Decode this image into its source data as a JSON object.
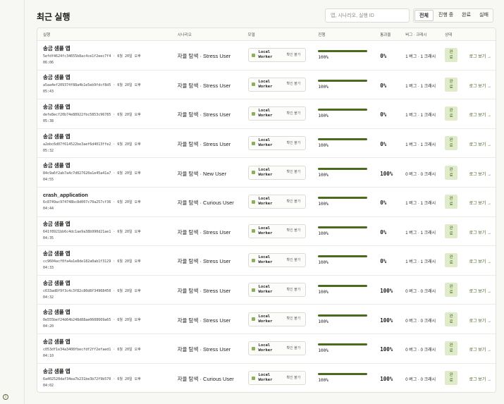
{
  "header": {
    "title": "최근 실행",
    "search_placeholder": "앱, 시나리오, 실행 ID",
    "tabs": [
      "전체",
      "진행 중",
      "완료",
      "실패"
    ],
    "active_tab": "전체"
  },
  "table": {
    "columns": [
      "실행",
      "시나리오",
      "모델",
      "진행",
      "통과율",
      "버그 · 크래시",
      "상태"
    ],
    "rows": [
      {
        "name": "송금 샘플 앱",
        "id": "5efdf4624fc34655b8ac4ce1f2eec7f4",
        "date": "6월 20일 오후",
        "time": "06:06",
        "scenario": "자율 탐색 · Stress User",
        "model": "Local Worker",
        "model_state": "확인 불가",
        "progress": 1.0,
        "progress_label": "100%",
        "pass_rate": "0%",
        "bugs": "1 버그 · 1 크래시",
        "status": "완료",
        "action": "로그 보기 →"
      },
      {
        "name": "송금 샘플 앱",
        "id": "a5aa4ef209374f88a4b1e5eb9fdcf8d5",
        "date": "6월 20일 오후",
        "time": "05:43",
        "scenario": "자율 탐색 · Stress User",
        "model": "Local Worker",
        "model_state": "확인 불가",
        "progress": 1.0,
        "progress_label": "100%",
        "pass_rate": "0%",
        "bugs": "1 버그 · 1 크래시",
        "status": "완료",
        "action": "로그 보기 →"
      },
      {
        "name": "송금 샘플 앱",
        "id": "defe8ecf20b74e88922fbc5853c96785",
        "date": "6월 20일 오후",
        "time": "05:38",
        "scenario": "자율 탐색 · Stress User",
        "model": "Local Worker",
        "model_state": "확인 불가",
        "progress": 1.0,
        "progress_label": "100%",
        "pass_rate": "0%",
        "bugs": "1 버그 · 1 크래시",
        "status": "완료",
        "action": "로그 보기 →"
      },
      {
        "name": "송금 샘플 앱",
        "id": "a2ebc6d07f614522be3aef6d4013ffe2",
        "date": "6월 20일 오후",
        "time": "05:32",
        "scenario": "자율 탐색 · Stress User",
        "model": "Local Worker",
        "model_state": "확인 불가",
        "progress": 1.0,
        "progress_label": "100%",
        "pass_rate": "0%",
        "bugs": "1 버그 · 1 크래시",
        "status": "완료",
        "action": "로그 보기 →"
      },
      {
        "name": "송금 샘플 앱",
        "id": "84c9a6f2ab7a4c7d827620a1e45a41a7",
        "date": "6월 20일 오후",
        "time": "04:55",
        "scenario": "자율 탐색 · New User",
        "model": "Local Worker",
        "model_state": "확인 불가",
        "progress": 1.0,
        "progress_label": "100%",
        "pass_rate": "100%",
        "bugs": "0 버그 · 0 크래시",
        "status": "완료",
        "action": "로그 보기 →"
      },
      {
        "name": "crash_application",
        "id": "6c8749ac974748bc8d007c70a257cf36",
        "date": "6월 20일 오후",
        "time": "04:44",
        "scenario": "자율 탐색 · Curious User",
        "model": "Local Worker",
        "model_state": "확인 불가",
        "progress": 1.0,
        "progress_label": "100%",
        "pass_rate": "0%",
        "bugs": "1 버그 · 1 크래시",
        "status": "완료",
        "action": "로그 보기 →"
      },
      {
        "name": "송금 샘플 앱",
        "id": "641f8921bb6c4dc1ae9a38b990d21ae1",
        "date": "6월 20일 오후",
        "time": "04:35",
        "scenario": "자율 탐색 · Stress User",
        "model": "Local Worker",
        "model_state": "확인 불가",
        "progress": 1.0,
        "progress_label": "100%",
        "pass_rate": "0%",
        "bugs": "1 버그 · 1 크래시",
        "status": "완료",
        "action": "로그 보기 →"
      },
      {
        "name": "송금 샘플 앱",
        "id": "cc9604acf0fa4a1e8de182a0ab1f3129",
        "date": "6월 20일 오후",
        "time": "04:33",
        "scenario": "자율 탐색 · Stress User",
        "model": "Local Worker",
        "model_state": "확인 불가",
        "progress": 1.0,
        "progress_label": "100%",
        "pass_rate": "0%",
        "bugs": "1 버그 · 1 크래시",
        "status": "완료",
        "action": "로그 보기 →"
      },
      {
        "name": "송금 샘플 앱",
        "id": "c633ad8f9f3c4c3f82c80d8f34968450",
        "date": "6월 20일 오후",
        "time": "04:32",
        "scenario": "자율 탐색 · Stress User",
        "model": "Local Worker",
        "model_state": "확인 불가",
        "progress": 1.0,
        "progress_label": "100%",
        "pass_rate": "100%",
        "bugs": "0 버그 · 0 크래시",
        "status": "완료",
        "action": "로그 보기 →"
      },
      {
        "name": "송금 샘플 앱",
        "id": "0e555bef24d64b248d88ae0608669a65",
        "date": "6월 20일 오후",
        "time": "04:20",
        "scenario": "자율 탐색 · Stress User",
        "model": "Local Worker",
        "model_state": "확인 불가",
        "progress": 1.0,
        "progress_label": "100%",
        "pass_rate": "100%",
        "bugs": "0 버그 · 0 크래시",
        "status": "완료",
        "action": "로그 보기 →"
      },
      {
        "name": "송금 샘플 앱",
        "id": "c053df1e34a3408fbecfdf2ff2efaed1",
        "date": "6월 20일 오후",
        "time": "04:10",
        "scenario": "자율 탐색 · Stress User",
        "model": "Local Worker",
        "model_state": "확인 불가",
        "progress": 1.0,
        "progress_label": "100%",
        "pass_rate": "100%",
        "bugs": "0 버그 · 0 크래시",
        "status": "완료",
        "action": "로그 보기 →"
      },
      {
        "name": "송금 샘플 앱",
        "id": "6a402520daf34ea7b231be3b72f9b570",
        "date": "6월 20일 오후",
        "time": "04:02",
        "scenario": "자율 탐색 · Curious User",
        "model": "Local Worker",
        "model_state": "확인 불가",
        "progress": 1.0,
        "progress_label": "100%",
        "pass_rate": "100%",
        "bugs": "0 버그 · 0 크래시",
        "status": "완료",
        "action": "로그 보기 →"
      }
    ]
  },
  "rail": {
    "icon": "info-icon"
  },
  "colors": {
    "accent": "#4a6b1c",
    "badge_bg": "#e0ecc9",
    "badge_text": "#3d5a14",
    "bar_track": "#e4ead7"
  }
}
